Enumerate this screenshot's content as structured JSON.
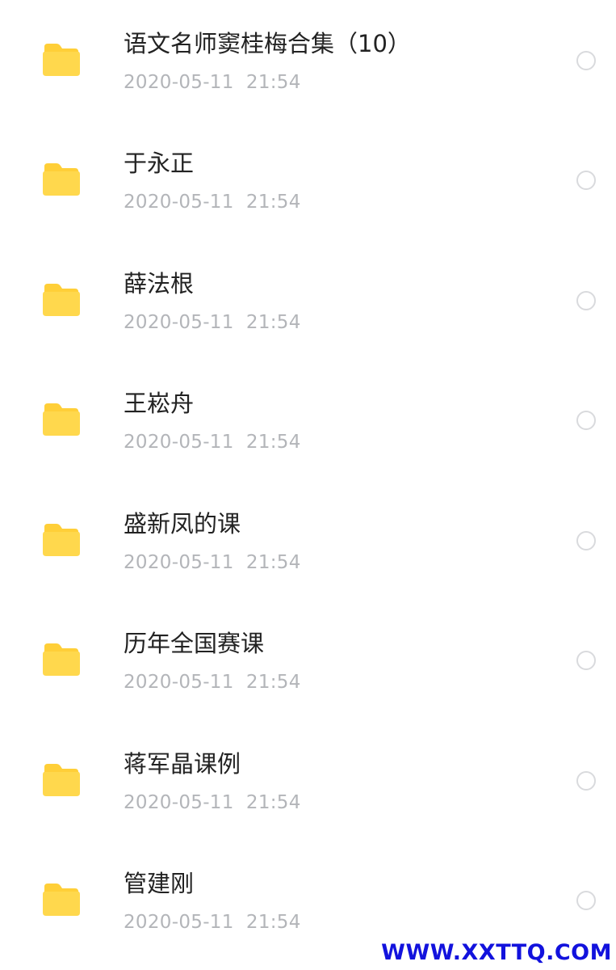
{
  "files": [
    {
      "name": "语文名师窦桂梅合集（10）",
      "date": "2020-05-11  21:54",
      "icon": "folder-icon"
    },
    {
      "name": "于永正",
      "date": "2020-05-11  21:54",
      "icon": "folder-icon"
    },
    {
      "name": "薛法根",
      "date": "2020-05-11  21:54",
      "icon": "folder-icon"
    },
    {
      "name": "王崧舟",
      "date": "2020-05-11  21:54",
      "icon": "folder-icon"
    },
    {
      "name": "盛新凤的课",
      "date": "2020-05-11  21:54",
      "icon": "folder-icon"
    },
    {
      "name": "历年全国赛课",
      "date": "2020-05-11  21:54",
      "icon": "folder-icon"
    },
    {
      "name": "蒋军晶课例",
      "date": "2020-05-11  21:54",
      "icon": "folder-icon"
    },
    {
      "name": "管建刚",
      "date": "2020-05-11  21:54",
      "icon": "folder-icon"
    }
  ],
  "watermark": "WWW.XXTTQ.COM",
  "colors": {
    "folder": "#ffd84d",
    "folder_tab": "#ffcf38",
    "title_text": "#222222",
    "date_text": "#b3b5b9",
    "radio_border": "#d9dadd",
    "watermark": "#1212dd"
  }
}
